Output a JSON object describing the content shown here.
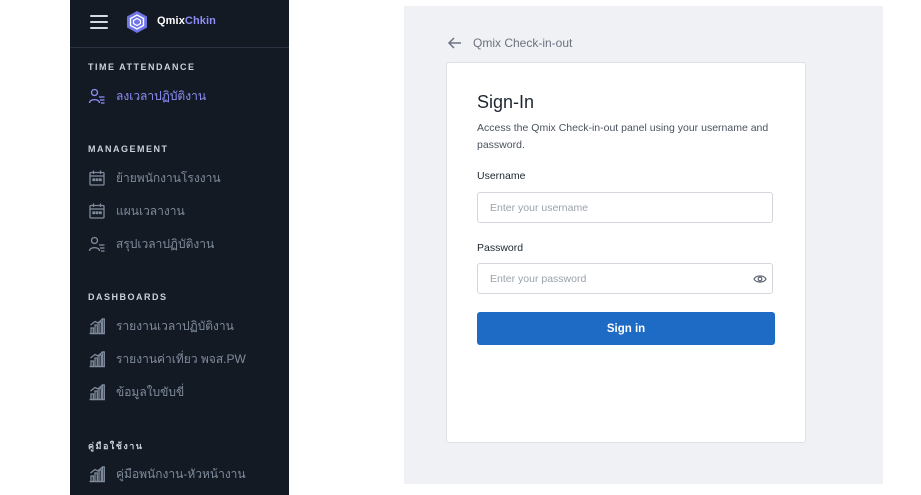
{
  "brand": {
    "part1": "Qmix",
    "part2": "Chkin"
  },
  "sidebar": {
    "sections": [
      {
        "title": "TIME ATTENDANCE",
        "items": [
          {
            "label": "ลงเวลาปฏิบัติงาน",
            "icon": "user-list-icon",
            "active": true
          }
        ]
      },
      {
        "title": "MANAGEMENT",
        "items": [
          {
            "label": "ย้ายพนักงานโรงงาน",
            "icon": "calendar-icon"
          },
          {
            "label": "แผนเวลางาน",
            "icon": "calendar-icon"
          },
          {
            "label": "สรุปเวลาปฏิบัติงาน",
            "icon": "user-list-icon"
          }
        ]
      },
      {
        "title": "DASHBOARDS",
        "items": [
          {
            "label": "รายงานเวลาปฏิบัติงาน",
            "icon": "bar-chart-icon"
          },
          {
            "label": "รายงานค่าเที่ยว พจส.PW",
            "icon": "bar-chart-icon"
          },
          {
            "label": "ข้อมูลใบขับขี่",
            "icon": "bar-chart-icon"
          }
        ]
      },
      {
        "title": "คู่มือใช้งาน",
        "items": [
          {
            "label": "คู่มือพนักงาน-หัวหน้างาน",
            "icon": "bar-chart-icon"
          }
        ]
      }
    ]
  },
  "breadcrumb": {
    "label": "Qmix Check-in-out"
  },
  "signin": {
    "title": "Sign-In",
    "description": "Access the Qmix Check-in-out panel using your username and password.",
    "username_label": "Username",
    "username_placeholder": "Enter your username",
    "password_label": "Password",
    "password_placeholder": "Enter your password",
    "button_label": "Sign in"
  },
  "colors": {
    "sidebar_bg": "#141a24",
    "accent": "#8b8ff5",
    "button": "#1d6bc4",
    "panel_bg": "#f0f1f4"
  }
}
